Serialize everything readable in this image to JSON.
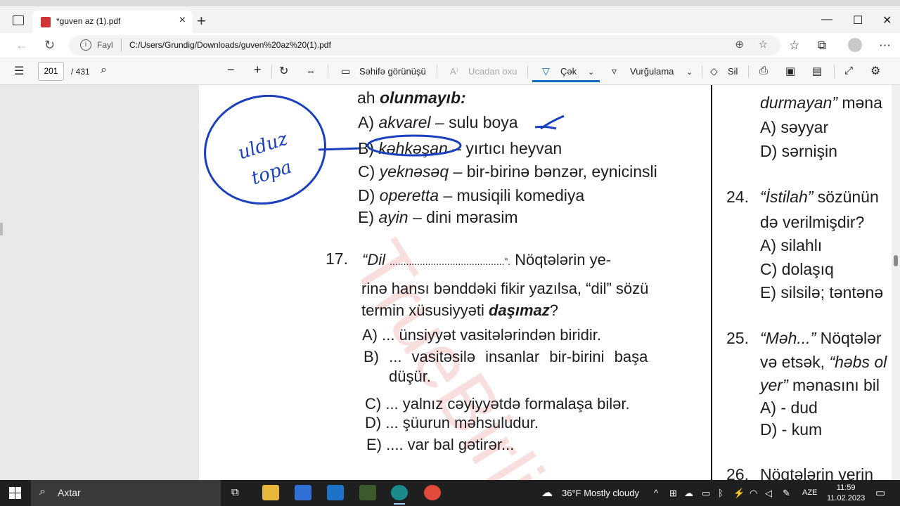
{
  "browser": {
    "tab_title": "*guven az (1).pdf",
    "url_scheme": "Fayl",
    "url": "C:/Users/Grundig/Downloads/guven%20az%20(1).pdf"
  },
  "pdf_toolbar": {
    "page_current": "201",
    "page_total": "/ 431",
    "page_view": "Səhifə görünüşü",
    "read_aloud": "Ucadan oxu",
    "draw": "Çək",
    "highlight": "Vurğulama",
    "erase": "Sil"
  },
  "document": {
    "left_col": {
      "q16_tail": "olunmayıb:",
      "q16_tail_prefix": "ah ",
      "q16_options": [
        {
          "letter": "A)",
          "word": "akvarel",
          "def": "– sulu boya"
        },
        {
          "letter": "B)",
          "word": "kəhkəşan",
          "def": "– yırtıcı heyvan"
        },
        {
          "letter": "C)",
          "word": "yeknəsəq",
          "def": "– bir-birinə bənzər, eynicinsli"
        },
        {
          "letter": "D)",
          "word": "operetta",
          "def": "– musiqili komediya"
        },
        {
          "letter": "E)",
          "word": "ayin",
          "def": "– dini mərasim"
        }
      ],
      "q17_num": "17.",
      "q17_line1_a": "“Dil",
      "q17_line1_b": "..........................................”.",
      "q17_line1_c": "Nöqtələrin ye-",
      "q17_line2": "rinə hansı bənddəki fikir yazılsa, “dil” sözü",
      "q17_line3_a": "termin xüsusiyyəti ",
      "q17_line3_b": "daşımaz",
      "q17_line3_c": "?",
      "q17_options": [
        "A) ... ünsiyyət vasitələrindən biridir.",
        "B)  ...  vasitəsilə  insanlar  bir-birini  başa",
        "düşür.",
        "C) ... yalnız cəyiyyətdə formalaşa bilər.",
        "D) ... şüurun məhsuludur.",
        "E) .... var bal gətirər..."
      ]
    },
    "right_col": {
      "top_line": "durmayan”",
      "top_line_b": " məna",
      "opt_a": "A) səyyar",
      "opt_d": "D) sərnişin",
      "q24_num": "24.",
      "q24_line1_a": "“İstilah”",
      "q24_line1_b": " sözünün",
      "q24_line2": "də verilmişdir?",
      "q24_a": "A) silahlı",
      "q24_c": "C) dolaşıq",
      "q24_e": "E) silsilə; təntənə",
      "q25_num": "25.",
      "q25_line1_a": "“Məh...”",
      "q25_line1_b": " Nöqtələr",
      "q25_line2_a": "və etsək, ",
      "q25_line2_b": "“həbs ol",
      "q25_line3_a": "yer”",
      "q25_line3_b": " mənasını bil",
      "q25_a": "A) - dud",
      "q25_d": "D) - kum",
      "q26_num": "26.",
      "q26_line1": "Nöqtələrin yerin"
    },
    "annotation_text": "ulduz topa"
  },
  "taskbar": {
    "search": "Axtar",
    "weather": "36°F  Mostly cloudy",
    "lang": "AZE",
    "time": "11:59",
    "date": "11.02.2023"
  }
}
